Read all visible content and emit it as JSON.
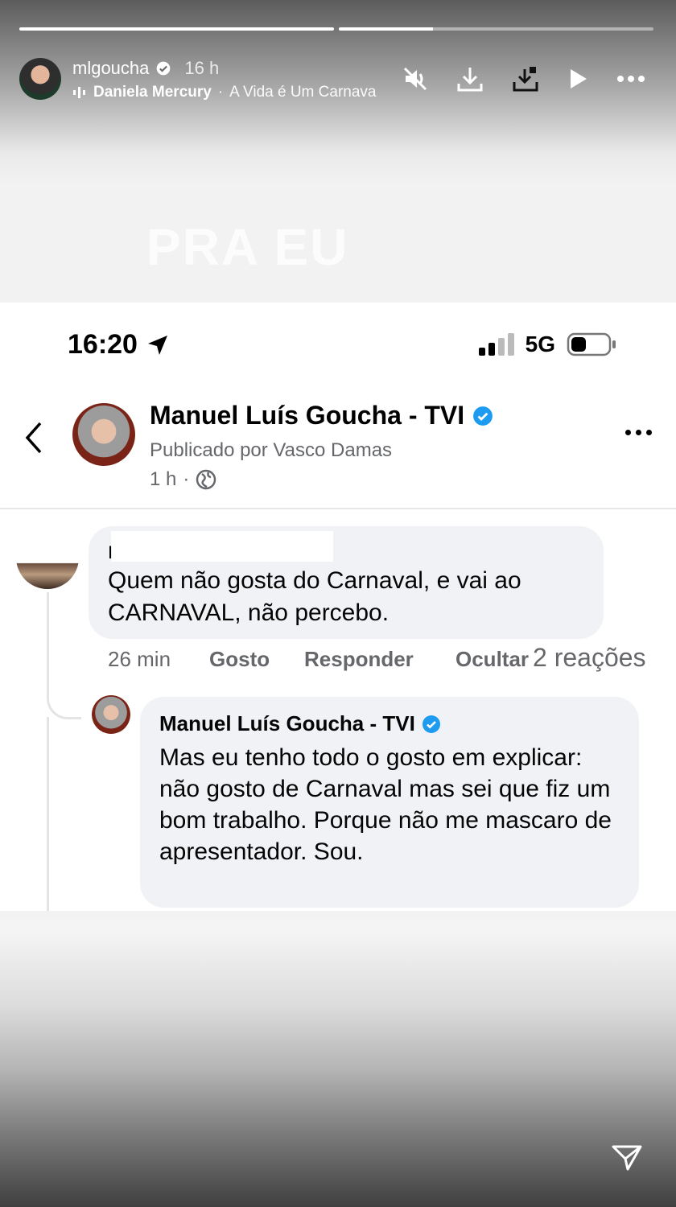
{
  "story": {
    "progress": [
      {
        "fill": 1.0
      },
      {
        "fill": 0.3
      }
    ],
    "username": "mlgoucha",
    "time": "16 h",
    "music": {
      "artist": "Daniela Mercury",
      "separator": "·",
      "song": "A Vida é Um Carnava"
    },
    "icons": [
      "mute-icon",
      "download-icon",
      "save-icon",
      "play-icon",
      "more-icon"
    ],
    "overlay_text": "PRA EU"
  },
  "phone": {
    "time": "16:20",
    "network": "5G"
  },
  "post": {
    "page_name": "Manuel Luís Goucha - TVI",
    "published_by": "Publicado por Vasco Damas",
    "time": "1 h",
    "separator": "·"
  },
  "comment": {
    "author_mark": "I",
    "text": "Quem não gosta do Carnaval, e vai ao CARNAVAL,  não percebo.",
    "time": "26 min",
    "like": "Gosto",
    "reply": "Responder",
    "hide": "Ocultar",
    "reactions": "2 reações"
  },
  "reply": {
    "author": "Manuel Luís Goucha - TVI",
    "text": "Mas eu tenho todo o gosto em explicar: não gosto de Carnaval mas sei que fiz um bom trabalho. Porque não me mascaro de apresentador. Sou."
  },
  "colors": {
    "verified_blue": "#1d9bf0",
    "meta_grey": "#65676b",
    "bubble": "#f0f2f5"
  }
}
